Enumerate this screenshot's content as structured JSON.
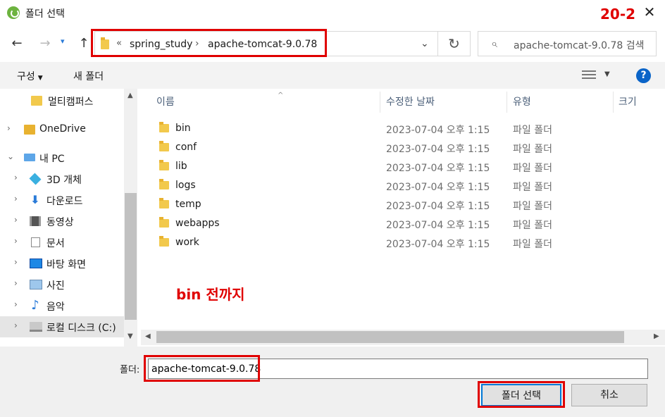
{
  "window": {
    "title": "폴더 선택",
    "close_label": "✕"
  },
  "annotations": {
    "top_right": "20-2",
    "middle": "bin 전까지"
  },
  "nav": {
    "back": "←",
    "forward": "→",
    "dropdown": "▾",
    "up": "↑",
    "breadcrumb_prefix": "«",
    "breadcrumb": [
      "spring_study",
      "apache-tomcat-9.0.78"
    ],
    "breadcrumb_sep": "›",
    "address_dropdown": "⌄",
    "refresh": "↻",
    "search_placeholder": "apache-tomcat-9.0.78 검색",
    "search_icon": "⌕"
  },
  "toolbar": {
    "organize": "구성",
    "organize_caret": "▼",
    "new_folder": "새 폴더",
    "view_caret": "▼",
    "help": "?"
  },
  "sidebar": {
    "items": [
      {
        "label": "멀티캠퍼스",
        "icon": "folder-icon",
        "chevron": ""
      },
      {
        "label": "OneDrive",
        "icon": "onedrive-icon",
        "chevron": "›"
      },
      {
        "label": "내 PC",
        "icon": "pc-icon",
        "chevron": "⌄"
      },
      {
        "label": "3D 개체",
        "icon": "3d-objects-icon",
        "chevron": "›"
      },
      {
        "label": "다운로드",
        "icon": "download-icon",
        "chevron": "›"
      },
      {
        "label": "동영상",
        "icon": "video-icon",
        "chevron": "›"
      },
      {
        "label": "문서",
        "icon": "document-icon",
        "chevron": "›"
      },
      {
        "label": "바탕 화면",
        "icon": "desktop-icon",
        "chevron": "›"
      },
      {
        "label": "사진",
        "icon": "pictures-icon",
        "chevron": "›"
      },
      {
        "label": "음악",
        "icon": "music-icon",
        "chevron": "›"
      },
      {
        "label": "로컬 디스크 (C:)",
        "icon": "drive-icon",
        "chevron": "›"
      }
    ],
    "scroll_up": "▲",
    "scroll_down": "▼"
  },
  "files": {
    "columns": [
      "이름",
      "수정한 날짜",
      "유형",
      "크기"
    ],
    "sort_indicator": "^",
    "rows": [
      {
        "name": "bin",
        "date": "2023-07-04 오후 1:15",
        "type": "파일 폴더"
      },
      {
        "name": "conf",
        "date": "2023-07-04 오후 1:15",
        "type": "파일 폴더"
      },
      {
        "name": "lib",
        "date": "2023-07-04 오후 1:15",
        "type": "파일 폴더"
      },
      {
        "name": "logs",
        "date": "2023-07-04 오후 1:15",
        "type": "파일 폴더"
      },
      {
        "name": "temp",
        "date": "2023-07-04 오후 1:15",
        "type": "파일 폴더"
      },
      {
        "name": "webapps",
        "date": "2023-07-04 오후 1:15",
        "type": "파일 폴더"
      },
      {
        "name": "work",
        "date": "2023-07-04 오후 1:15",
        "type": "파일 폴더"
      }
    ],
    "scroll_left": "◀",
    "scroll_right": "▶"
  },
  "footer": {
    "folder_label": "폴더:",
    "folder_value": "apache-tomcat-9.0.78",
    "select_button": "폴더 선택",
    "cancel_button": "취소"
  },
  "colors": {
    "annotation": "#e00000",
    "accent": "#0078d7",
    "folder": "#f2c94c"
  }
}
